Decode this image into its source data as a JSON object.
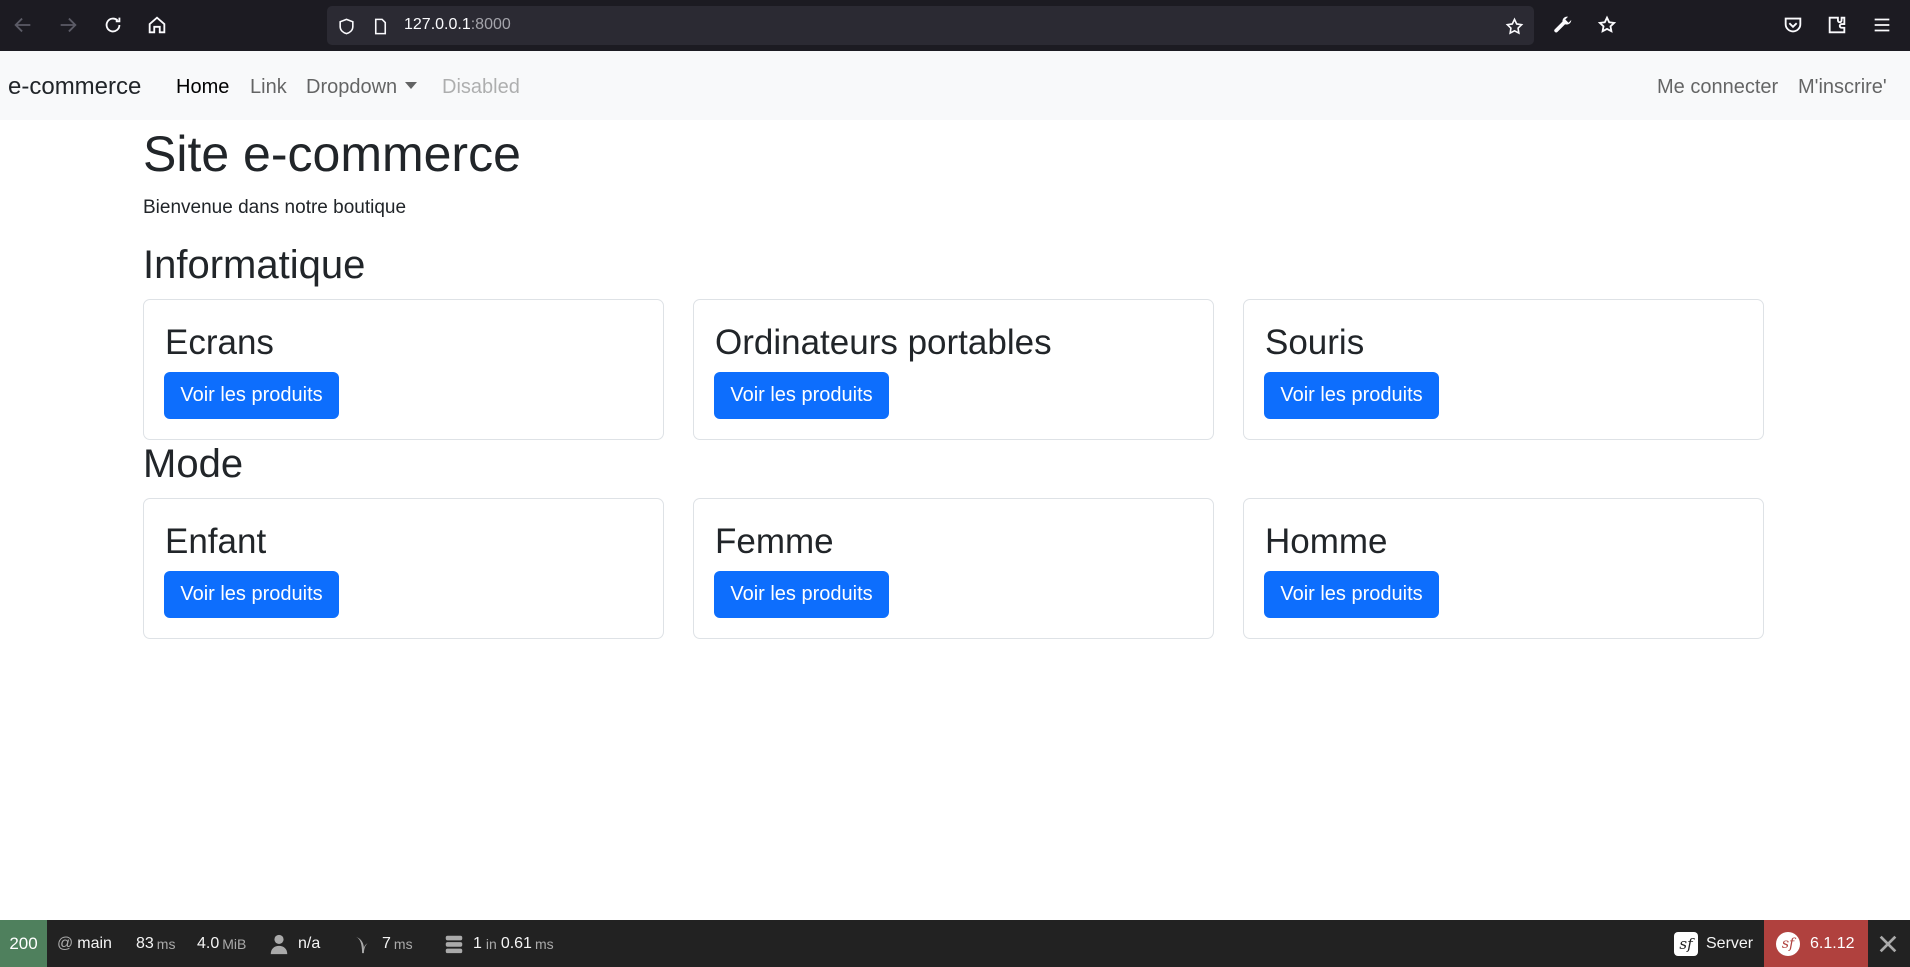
{
  "browser": {
    "url_host": "127.0.0.1",
    "url_port": ":8000"
  },
  "navbar": {
    "brand": "e-commerce",
    "links": [
      {
        "label": "Home"
      },
      {
        "label": "Link"
      },
      {
        "label": "Dropdown"
      },
      {
        "label": "Disabled"
      }
    ],
    "right_links": [
      {
        "label": "Me connecter"
      },
      {
        "label": "M'inscrire'"
      }
    ]
  },
  "main": {
    "title": "Site e-commerce",
    "subtitle": "Bienvenue dans notre boutique",
    "sections": [
      {
        "title": "Informatique",
        "cards": [
          {
            "title": "Ecrans",
            "button": "Voir les produits"
          },
          {
            "title": "Ordinateurs portables",
            "button": "Voir les produits"
          },
          {
            "title": "Souris",
            "button": "Voir les produits"
          }
        ]
      },
      {
        "title": "Mode",
        "cards": [
          {
            "title": "Enfant",
            "button": "Voir les produits"
          },
          {
            "title": "Femme",
            "button": "Voir les produits"
          },
          {
            "title": "Homme",
            "button": "Voir les produits"
          }
        ]
      }
    ]
  },
  "toolbar": {
    "status_code": "200",
    "route_at": "@",
    "route": "main",
    "time_value": "83",
    "time_unit": "ms",
    "memory_value": "4.0",
    "memory_unit": "MiB",
    "user": "n/a",
    "twig_value": "7",
    "twig_unit": "ms",
    "db_queries": "1",
    "db_in": "in",
    "db_time": "0.61",
    "db_unit": "ms",
    "server_label": "Server",
    "version": "6.1.12"
  },
  "colors": {
    "primary": "#0d6efd",
    "status_ok": "#4f805d",
    "version_bg": "#b0413e"
  }
}
